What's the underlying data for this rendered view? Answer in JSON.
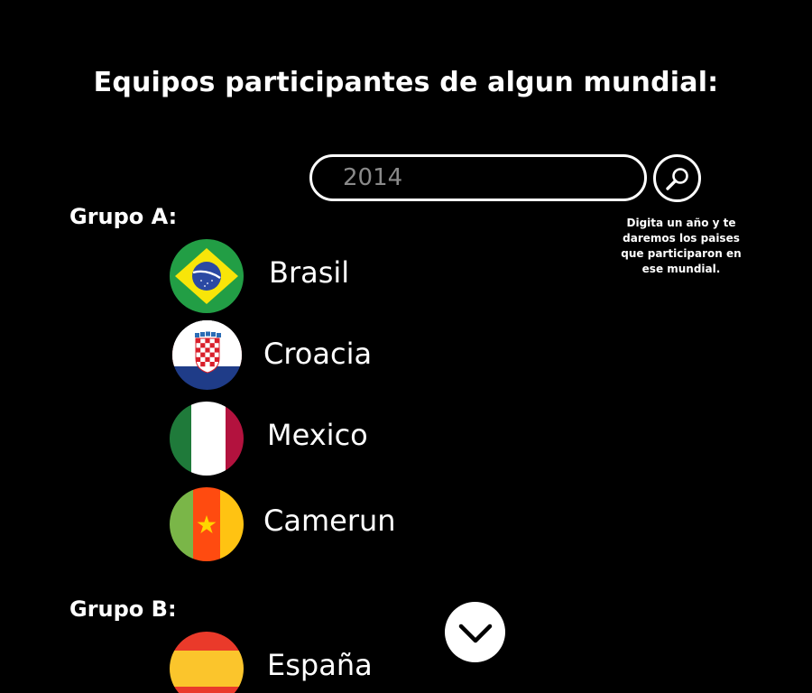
{
  "header": {
    "title": "Equipos participantes de algun mundial:"
  },
  "search": {
    "value": "",
    "placeholder": "2014",
    "button_icon": "search-icon",
    "helper_text": "Digita un año y te daremos los paises que participaron en ese mundial."
  },
  "groups": [
    {
      "title": "Grupo A:",
      "teams": [
        {
          "name": "Brasil",
          "flag": "brazil-flag-icon"
        },
        {
          "name": "Croacia",
          "flag": "croatia-flag-icon"
        },
        {
          "name": "Mexico",
          "flag": "mexico-flag-icon"
        },
        {
          "name": "Camerun",
          "flag": "cameroon-flag-icon"
        }
      ]
    },
    {
      "title": "Grupo B:",
      "teams": [
        {
          "name": "España",
          "flag": "spain-flag-icon"
        }
      ]
    }
  ],
  "scroll_button": {
    "icon": "chevron-down-icon"
  },
  "colors": {
    "background": "#000000",
    "text": "#ffffff",
    "placeholder": "#8a8a8a"
  }
}
